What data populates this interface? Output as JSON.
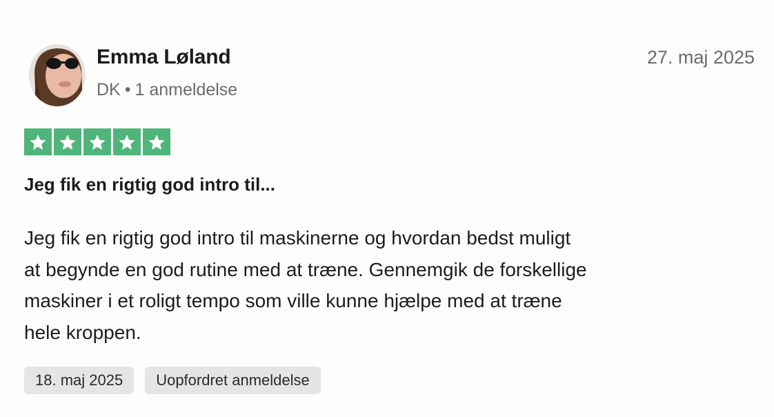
{
  "review": {
    "reviewer": {
      "name": "Emma Løland",
      "country": "DK",
      "separator": "•",
      "review_count": "1 anmeldelse"
    },
    "date": "27. maj 2025",
    "rating": 5,
    "rating_color": "#4fb57a",
    "title": "Jeg fik en rigtig god intro til...",
    "body_lines": [
      "Jeg fik en rigtig god intro til maskinerne og hvordan bedst muligt",
      "at begynde en god rutine med at træne. Gennemgik de forskellige",
      "maskiner i et roligt tempo som ville kunne hjælpe med at træne",
      "hele kroppen."
    ],
    "experience_date": "18. maj 2025",
    "label": "Uopfordret anmeldelse"
  }
}
